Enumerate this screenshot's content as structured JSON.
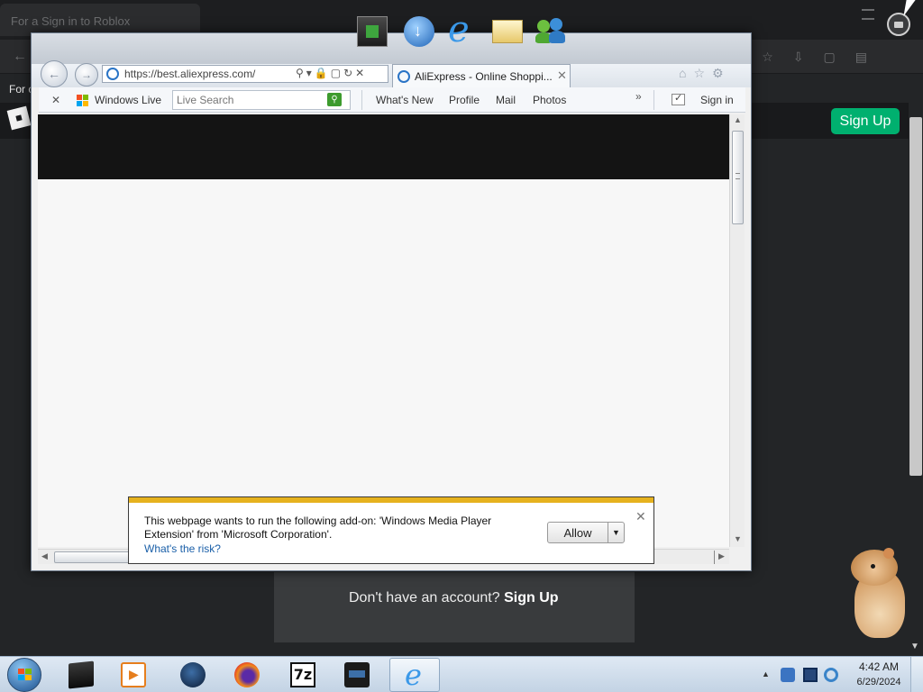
{
  "background_page": {
    "tab_title": "For a Sign in to Roblox",
    "infobar_text": "For c",
    "signup_button": "Sign Up",
    "dont_have_text": "Don't have an account?",
    "signup_link": "Sign Up",
    "colors": {
      "signup_green": "#00b06f",
      "page_bg": "#232527"
    }
  },
  "dock_icons": [
    "media-center-icon",
    "download-globe-icon",
    "internet-explorer-icon",
    "mail-icon",
    "messenger-icon"
  ],
  "ie": {
    "address_url": "https://best.aliexpress.com/",
    "tab_title": "AliExpress - Online Shoppi...",
    "toolbar": {
      "windows_live_label": "Windows Live",
      "search_placeholder": "Live Search",
      "links": [
        "What's New",
        "Profile",
        "Mail",
        "Photos"
      ],
      "more_label": "»",
      "sign_in_label": "Sign in"
    }
  },
  "addon_notification": {
    "message": "This webpage wants to run the following add-on: 'Windows Media Player Extension' from 'Microsoft Corporation'.",
    "risk_link": "What's the risk?",
    "allow_button": "Allow",
    "stripe_color": "#e6b21e"
  },
  "taskbar": {
    "time": "4:42 AM",
    "date": "6/29/2024",
    "pinned": [
      "app-dark-window",
      "media-player",
      "browser-globe",
      "firefox",
      "7-zip",
      "dark-app",
      "internet-explorer"
    ],
    "seven_zip_label": "7z"
  }
}
